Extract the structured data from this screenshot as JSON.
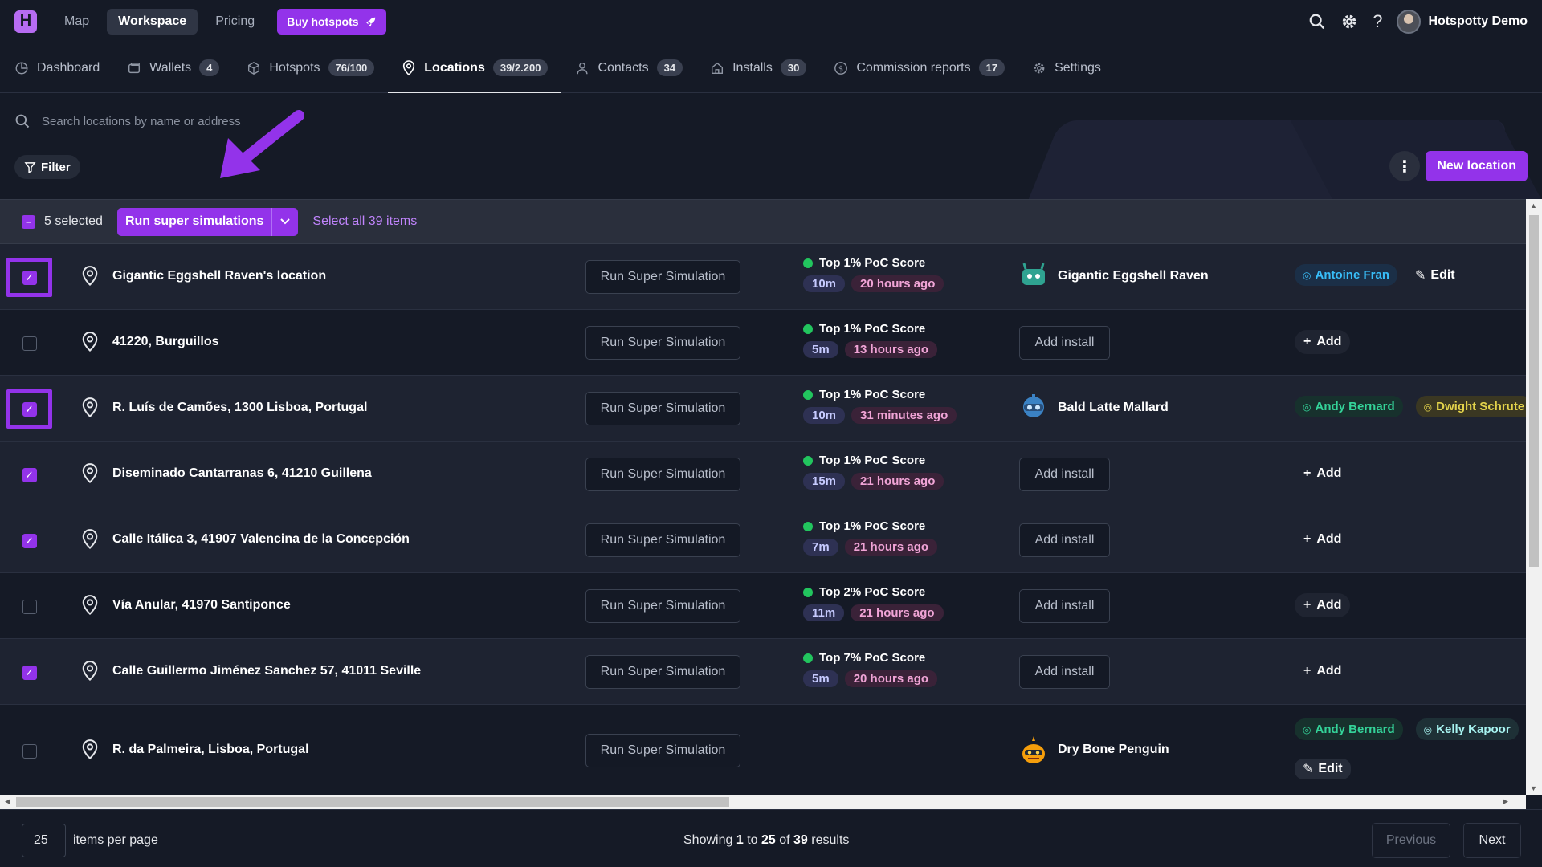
{
  "app": {
    "logo_letter": "H",
    "accent_color": "#9333ea",
    "nav": [
      {
        "label": "Map",
        "active": false
      },
      {
        "label": "Workspace",
        "active": true
      },
      {
        "label": "Pricing",
        "active": false
      }
    ],
    "buy_label": "Buy hotspots",
    "user_name": "Hotspotty Demo"
  },
  "tabs": [
    {
      "icon": "dashboard-icon",
      "label": "Dashboard",
      "count": ""
    },
    {
      "icon": "wallet-icon",
      "label": "Wallets",
      "count": "4"
    },
    {
      "icon": "cube-icon",
      "label": "Hotspots",
      "count": "76/100"
    },
    {
      "icon": "location-pin-icon",
      "label": "Locations",
      "count": "39/2.200",
      "active": true
    },
    {
      "icon": "user-icon",
      "label": "Contacts",
      "count": "34"
    },
    {
      "icon": "home-icon",
      "label": "Installs",
      "count": "30"
    },
    {
      "icon": "dollar-icon",
      "label": "Commission reports",
      "count": "17"
    },
    {
      "icon": "gear-icon",
      "label": "Settings",
      "count": ""
    }
  ],
  "toolbar": {
    "search_placeholder": "Search locations by name or address",
    "filter_label": "Filter",
    "new_location_label": "New location"
  },
  "selection": {
    "selected_text": "5 selected",
    "bulk_action_label": "Run super simulations",
    "select_all_label": "Select all 39 items"
  },
  "rows": [
    {
      "name": "Gigantic Eggshell Raven's location",
      "checked": true,
      "highlighted": true,
      "sim_label": "Run Super Simulation",
      "poc": "Top 1% PoC Score",
      "time": "10m",
      "ago": "20 hours ago",
      "hotspot": "Gigantic Eggshell Raven",
      "hotspot_icon": "robot-green-icon",
      "contacts": [
        {
          "name": "Antoine Fran",
          "color": "blue"
        }
      ],
      "action": "Edit"
    },
    {
      "name": "41220, Burguillos",
      "checked": false,
      "highlighted": false,
      "sim_label": "Run Super Simulation",
      "poc": "Top 1% PoC Score",
      "time": "5m",
      "ago": "13 hours ago",
      "install_label": "Add install",
      "contacts": [],
      "action": "Add"
    },
    {
      "name": "R. Luís de Camões, 1300 Lisboa, Portugal",
      "checked": true,
      "highlighted": true,
      "sim_label": "Run Super Simulation",
      "poc": "Top 1% PoC Score",
      "time": "10m",
      "ago": "31 minutes ago",
      "hotspot": "Bald Latte Mallard",
      "hotspot_icon": "robot-blue-icon",
      "contacts": [
        {
          "name": "Andy Bernard",
          "color": "green"
        },
        {
          "name": "Dwight Schrute",
          "color": "yellow"
        }
      ],
      "action": ""
    },
    {
      "name": "Diseminado Cantarranas 6, 41210 Guillena",
      "checked": true,
      "highlighted": false,
      "sim_label": "Run Super Simulation",
      "poc": "Top 1% PoC Score",
      "time": "15m",
      "ago": "21 hours ago",
      "install_label": "Add install",
      "contacts": [],
      "action": "Add"
    },
    {
      "name": "Calle Itálica 3, 41907 Valencina de la Concepción",
      "checked": true,
      "highlighted": false,
      "sim_label": "Run Super Simulation",
      "poc": "Top 1% PoC Score",
      "time": "7m",
      "ago": "21 hours ago",
      "install_label": "Add install",
      "contacts": [],
      "action": "Add"
    },
    {
      "name": "Vía Anular, 41970 Santiponce",
      "checked": false,
      "highlighted": false,
      "sim_label": "Run Super Simulation",
      "poc": "Top 2% PoC Score",
      "time": "11m",
      "ago": "21 hours ago",
      "install_label": "Add install",
      "contacts": [],
      "action": "Add"
    },
    {
      "name": "Calle Guillermo Jiménez Sanchez 57, 41011 Seville",
      "checked": true,
      "highlighted": false,
      "sim_label": "Run Super Simulation",
      "poc": "Top 7% PoC Score",
      "time": "5m",
      "ago": "20 hours ago",
      "install_label": "Add install",
      "contacts": [],
      "action": "Add"
    },
    {
      "name": "R. da Palmeira, Lisboa, Portugal",
      "checked": false,
      "highlighted": false,
      "sim_label": "Run Super Simulation",
      "poc": "",
      "time": "",
      "ago": "",
      "hotspot": "Dry Bone Penguin",
      "hotspot_icon": "pumpkin-robot-icon",
      "contacts": [
        {
          "name": "Andy Bernard",
          "color": "green"
        },
        {
          "name": "Kelly Kapoor",
          "color": "teal"
        }
      ],
      "action": "Edit"
    }
  ],
  "footer": {
    "per_page": "25",
    "per_page_label": "items per page",
    "showing_prefix": "Showing",
    "from": "1",
    "to_word": "to",
    "to": "25",
    "of_word": "of",
    "total": "39",
    "results_word": "results",
    "previous_label": "Previous",
    "next_label": "Next"
  }
}
